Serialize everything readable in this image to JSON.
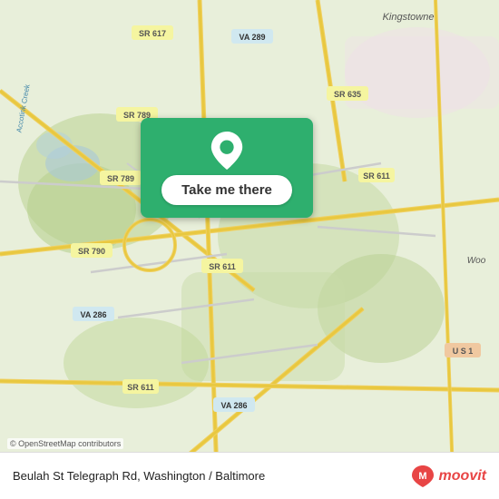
{
  "map": {
    "attribution": "© OpenStreetMap contributors",
    "backgroundColor": "#e8f0d8"
  },
  "button": {
    "label": "Take me there",
    "pinColor": "#ffffff"
  },
  "bottomBar": {
    "address": "Beulah St Telegraph Rd, Washington / Baltimore",
    "logoText": "moovit"
  }
}
